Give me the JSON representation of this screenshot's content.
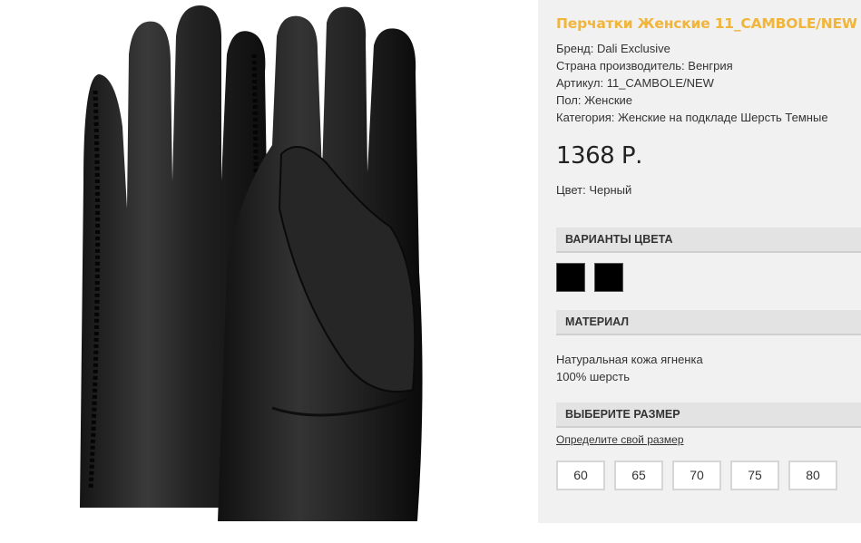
{
  "product": {
    "title": "Перчатки Женские 11_CAMBOLE/NEW",
    "image_alt": "black-leather-gloves",
    "meta": [
      "Бренд: Dali Exclusive",
      "Страна производитель: Венгрия",
      "Артикул: 11_CAMBOLE/NEW",
      "Пол: Женские",
      "Категория: Женские на подкладе Шерсть Темные"
    ],
    "price": "1368 Р.",
    "color": "Цвет: Черный"
  },
  "sections": {
    "colors_header": "ВАРИАНТЫ ЦВЕТА",
    "material_header": "МАТЕРИАЛ",
    "size_header": "ВЫБЕРИТЕ РАЗМЕР"
  },
  "swatches": [
    {
      "name": "black",
      "color": "#000000"
    },
    {
      "name": "black",
      "color": "#000000"
    }
  ],
  "material": [
    "Натуральная кожа ягненка",
    "100% шерсть"
  ],
  "size_link": "Определите свой размер",
  "sizes": [
    "60",
    "65",
    "70",
    "75",
    "80"
  ],
  "theme": {
    "accent": "#f0b53a",
    "panel_bg": "#f1f1f1"
  }
}
